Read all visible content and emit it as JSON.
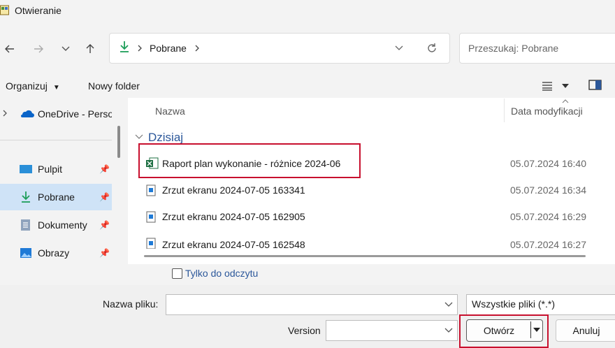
{
  "window": {
    "title": "Otwieranie"
  },
  "address": {
    "crumb": "Pobrane"
  },
  "search": {
    "placeholder": "Przeszukaj: Pobrane"
  },
  "toolbar": {
    "organize": "Organizuj",
    "new_folder": "Nowy folder"
  },
  "sidebar": {
    "items": [
      {
        "label": "OneDrive - Perso"
      },
      {
        "label": "Pulpit"
      },
      {
        "label": "Pobrane"
      },
      {
        "label": "Dokumenty"
      },
      {
        "label": "Obrazy"
      }
    ]
  },
  "columns": {
    "name": "Nazwa",
    "date": "Data modyfikacji"
  },
  "group": {
    "label": "Dzisiaj"
  },
  "files": [
    {
      "name": "Raport plan wykonanie - różnice 2024-06",
      "date": "05.07.2024 16:40",
      "icon": "excel-icon"
    },
    {
      "name": "Zrzut ekranu 2024-07-05 163341",
      "date": "05.07.2024 16:34",
      "icon": "image-file-icon"
    },
    {
      "name": "Zrzut ekranu 2024-07-05 162905",
      "date": "05.07.2024 16:29",
      "icon": "image-file-icon"
    },
    {
      "name": "Zrzut ekranu 2024-07-05 162548",
      "date": "05.07.2024 16:27",
      "icon": "image-file-icon"
    }
  ],
  "readonly": {
    "label": "Tylko do odczytu"
  },
  "filename": {
    "label": "Nazwa pliku:",
    "value": ""
  },
  "filter": {
    "value": "Wszystkie pliki (*.*)"
  },
  "version": {
    "label": "Version",
    "value": ""
  },
  "buttons": {
    "open": "Otwórz",
    "cancel": "Anuluj"
  },
  "colors": {
    "accent": "#2b579a",
    "highlight": "#c8102e",
    "selected": "#cfe3f7"
  }
}
